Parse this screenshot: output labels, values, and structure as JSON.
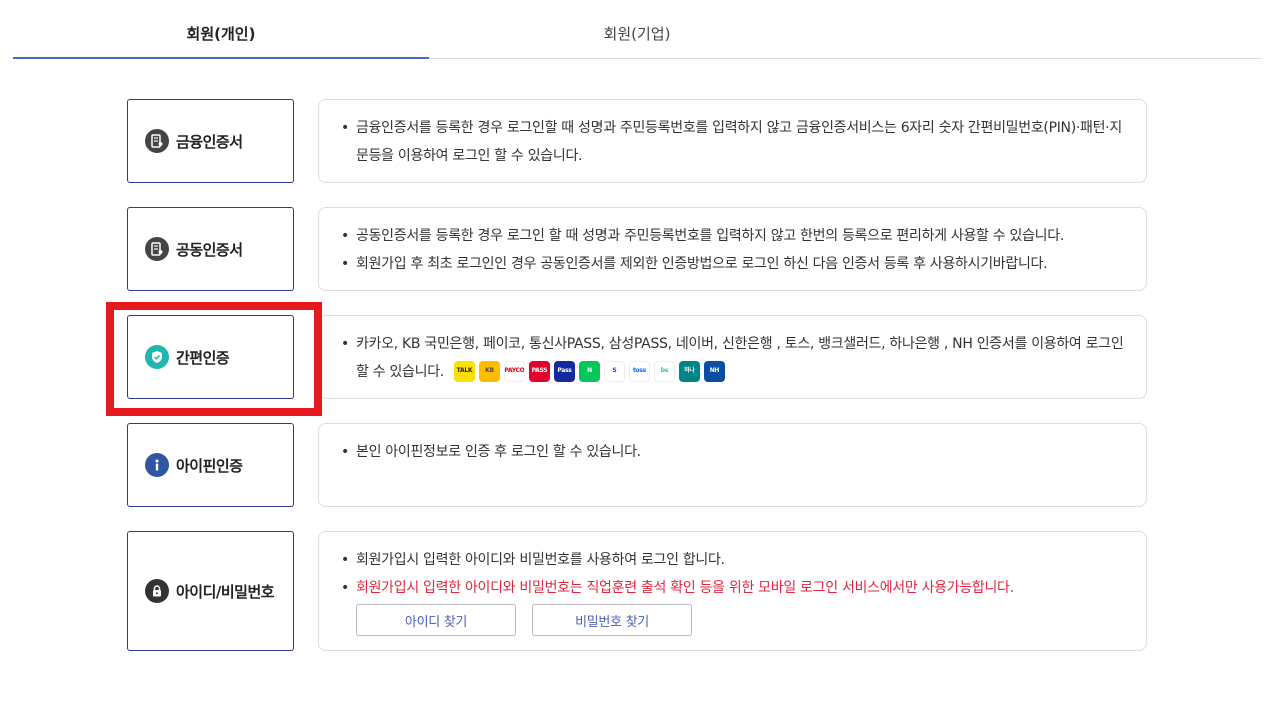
{
  "tabs": [
    {
      "label": "회원(개인)",
      "active": true
    },
    {
      "label": "회원(기업)",
      "active": false
    }
  ],
  "methods": [
    {
      "label": "금융인증서",
      "icon": "certificate-icon",
      "desc": [
        "금융인증서를 등록한 경우 로그인할 때 성명과 주민등록번호를 입력하지 않고 금융인증서비스는 6자리 숫자 간편비밀번호(PIN)·패턴·지문등을 이용하여 로그인 할 수 있습니다."
      ]
    },
    {
      "label": "공동인증서",
      "icon": "certificate-icon",
      "desc": [
        "공동인증서를 등록한 경우 로그인 할 때 성명과 주민등록번호를 입력하지 않고 한번의 등록으로 편리하게 사용할 수 있습니다.",
        "회원가입 후 최초 로그인인 경우 공동인증서를 제외한 인증방법으로 로그인 하신 다음 인증서 등록 후 사용하시기바랍니다."
      ]
    },
    {
      "label": "간편인증",
      "icon": "shield-check-icon",
      "desc": [
        "카카오, KB 국민은행, 페이코, 통신사PASS, 삼성PASS, 네이버, 신한은행 , 토스, 뱅크샐러드, 하나은행 , NH 인증서를 이용하여 로그인 할 수 있습니다."
      ]
    },
    {
      "label": "아이핀인증",
      "icon": "info-icon",
      "desc": [
        "본인 아이핀정보로 인증 후 로그인 할 수 있습니다."
      ]
    },
    {
      "label": "아이디/비밀번호",
      "icon": "lock-icon",
      "desc": [
        "회원가입시 입력한 아이디와 비밀번호를 사용하여 로그인 합니다."
      ],
      "warning": "회원가입시 입력한 아이디와 비밀번호는 직업훈련 출석 확인 등을 위한 모바일 로그인 서비스에서만 사용가능합니다.",
      "buttons": [
        "아이디 찾기",
        "비밀번호 찾기"
      ]
    }
  ],
  "simple_auth_logos": [
    {
      "name": "kakao-talk-logo-icon",
      "text": "TALK",
      "bg": "#fae100",
      "fg": "#3c1e1e"
    },
    {
      "name": "kb-logo-icon",
      "text": "KB",
      "bg": "#ffbc00",
      "fg": "#594a3c"
    },
    {
      "name": "payco-logo-icon",
      "text": "PAYCO",
      "bg": "#ffffff",
      "fg": "#e3001b"
    },
    {
      "name": "pass-telecom-logo-icon",
      "text": "PASS",
      "bg": "#e3002d",
      "fg": "#ffffff"
    },
    {
      "name": "samsung-pass-logo-icon",
      "text": "Pass",
      "bg": "#1428a0",
      "fg": "#ffffff"
    },
    {
      "name": "naver-logo-icon",
      "text": "N",
      "bg": "#03c75a",
      "fg": "#ffffff"
    },
    {
      "name": "shinhan-logo-icon",
      "text": "S",
      "bg": "#ffffff",
      "fg": "#0046ff"
    },
    {
      "name": "toss-logo-icon",
      "text": "toss",
      "bg": "#ffffff",
      "fg": "#0064ff"
    },
    {
      "name": "banksalad-logo-icon",
      "text": "bs",
      "bg": "#ffffff",
      "fg": "#2ecc9a"
    },
    {
      "name": "hana-logo-icon",
      "text": "하나",
      "bg": "#008485",
      "fg": "#ffffff"
    },
    {
      "name": "nh-logo-icon",
      "text": "NH",
      "bg": "#0a4ea1",
      "fg": "#ffffff"
    }
  ],
  "colors": {
    "accent": "#4a66c5",
    "border": "#2b3a8c",
    "highlight": "#e8181f",
    "warning": "#e0263f"
  }
}
